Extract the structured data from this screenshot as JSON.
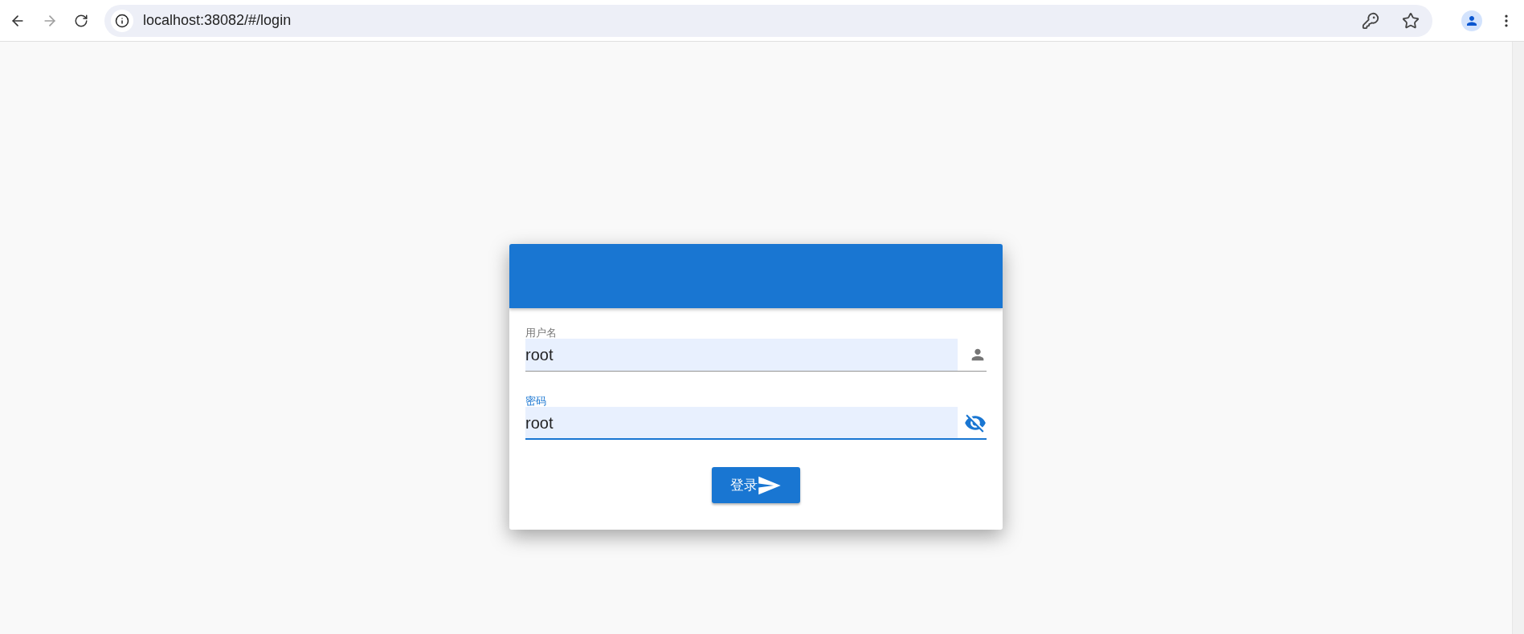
{
  "browser": {
    "back": {
      "disabled": false
    },
    "forward": {
      "disabled": true
    },
    "url": "localhost:38082/#/login"
  },
  "login_form": {
    "fields": [
      {
        "kind": "text",
        "label": "用户名",
        "value": "root",
        "focused": false
      },
      {
        "kind": "password",
        "label": "密码",
        "value": "root",
        "focused": true
      }
    ],
    "submit_button": "登录"
  }
}
